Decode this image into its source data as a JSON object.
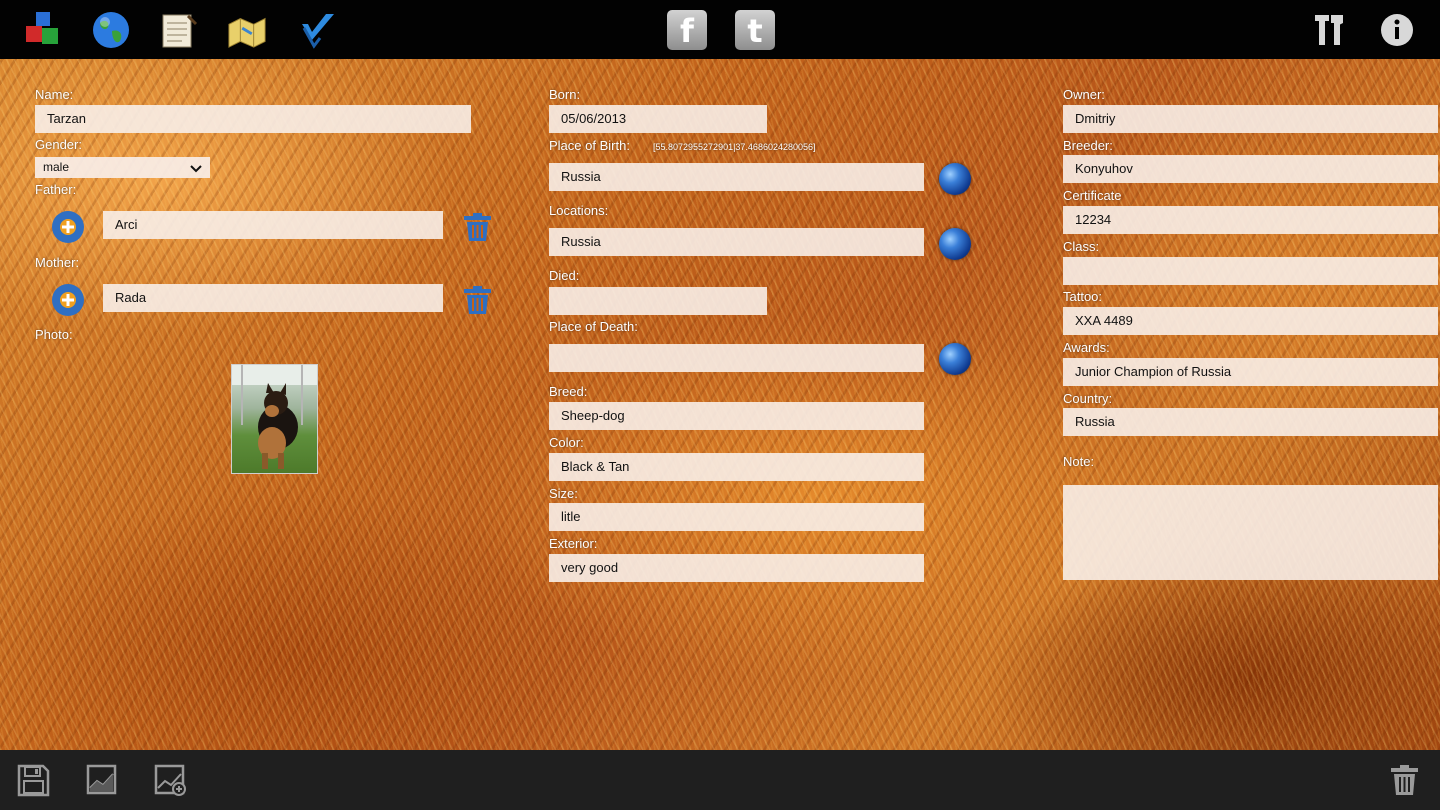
{
  "toolbar": {
    "left_icons": [
      "cubes-icon",
      "globe-icon",
      "notepad-icon",
      "map-icon",
      "checkmark-icon"
    ],
    "social": [
      {
        "name": "facebook-icon",
        "glyph": "f"
      },
      {
        "name": "twitter-icon",
        "glyph": "t"
      }
    ],
    "right_icons": [
      "tools-icon",
      "info-icon"
    ]
  },
  "col1": {
    "name_label": "Name:",
    "name_value": "Tarzan",
    "gender_label": "Gender:",
    "gender_value": "male",
    "father_label": "Father:",
    "father_value": "Arci",
    "mother_label": "Mother:",
    "mother_value": "Rada",
    "photo_label": "Photo:"
  },
  "col2": {
    "born_label": "Born:",
    "born_value": "05/06/2013",
    "birth_place_label": "Place of Birth:",
    "birth_coords": "[55.8072955272901|37.4686024280056]",
    "birth_place_value": "Russia",
    "locations_label": "Locations:",
    "locations_value": "Russia",
    "died_label": "Died:",
    "died_value": "",
    "death_place_label": "Place of Death:",
    "death_place_value": "",
    "breed_label": "Breed:",
    "breed_value": "Sheep-dog",
    "color_label": "Color:",
    "color_value": "Black & Tan",
    "size_label": "Size:",
    "size_value": "litle",
    "exterior_label": "Exterior:",
    "exterior_value": "very good"
  },
  "col3": {
    "owner_label": "Owner:",
    "owner_value": "Dmitriy",
    "breeder_label": "Breeder:",
    "breeder_value": "Konyuhov",
    "certificate_label": "Certificate",
    "certificate_value": "12234",
    "class_label": "Class:",
    "class_value": "",
    "tattoo_label": "Tattoo:",
    "tattoo_value": "XXA 4489",
    "awards_label": "Awards:",
    "awards_value": "Junior Champion of Russia",
    "country_label": "Country:",
    "country_value": "Russia",
    "note_label": "Note:",
    "note_value": ""
  },
  "bottombar": {
    "icons": [
      "save-icon",
      "chart-icon",
      "chart-edit-icon",
      "trash-icon"
    ]
  },
  "colors": {
    "topbar": "#020202",
    "bottombar": "#1f1f1f",
    "field_bg": "#f8eee8",
    "accent_blue": "#2f6fc2",
    "fur_orange": "#c2621b"
  }
}
